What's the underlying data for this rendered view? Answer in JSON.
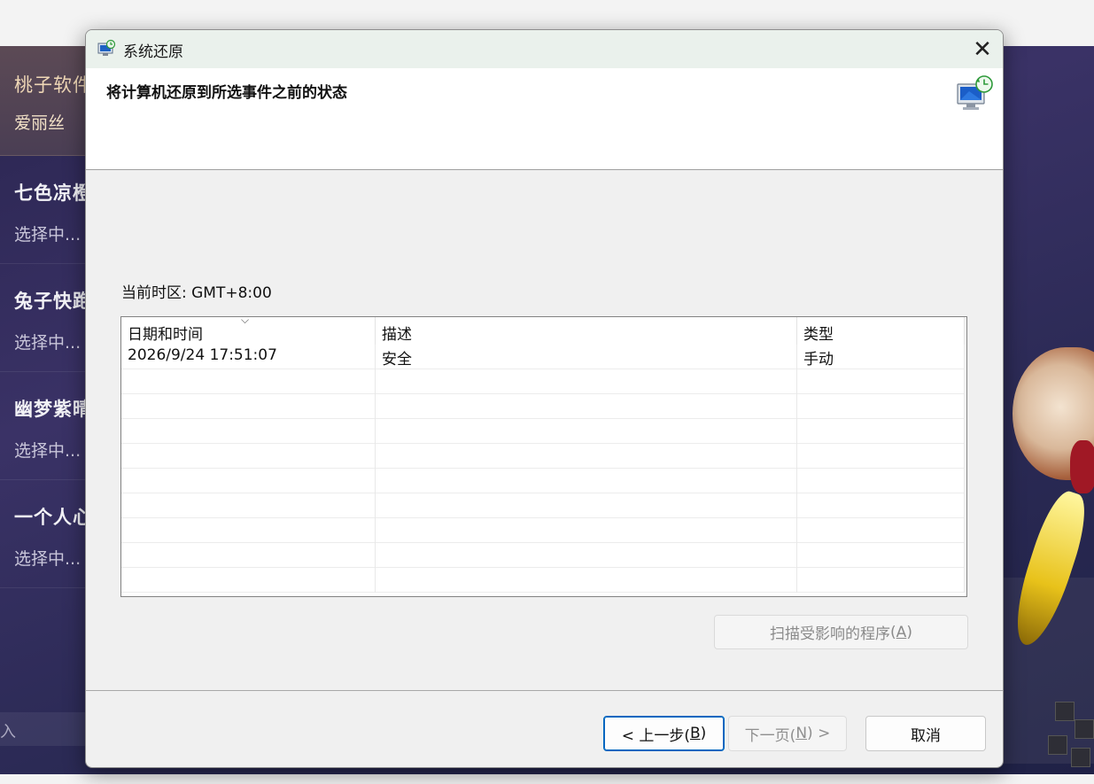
{
  "background_app": {
    "items": [
      {
        "title": "桃子软件",
        "subtitle": "爱丽丝"
      },
      {
        "title": "七色凉橙",
        "subtitle": "选择中..."
      },
      {
        "title": "兔子快跑",
        "subtitle": "选择中..."
      },
      {
        "title": "幽梦紫晴",
        "subtitle": "选择中..."
      },
      {
        "title": "一个人心",
        "subtitle": "选择中..."
      }
    ],
    "input_text": "入"
  },
  "dialog": {
    "title": "系统还原",
    "close_glyph": "✕",
    "header_title": "将计算机还原到所选事件之前的状态",
    "timezone_label": "当前时区: GMT+8:00",
    "table": {
      "sort_glyph": "⌵",
      "columns": [
        "日期和时间",
        "描述",
        "类型"
      ],
      "rows": [
        [
          "2026/9/24 17:51:07",
          "安全",
          "手动"
        ]
      ],
      "empty_rows": 9
    },
    "scan_button": {
      "label": "扫描受影响的程序",
      "accel": "A"
    },
    "buttons": {
      "back": {
        "prefix": "< 上一步(",
        "accel": "B",
        "suffix": ")"
      },
      "next": {
        "prefix": "下一页(",
        "accel": "N",
        "suffix": ") >"
      },
      "cancel": "取消"
    }
  },
  "icons": {
    "title_icon": "system-restore-icon",
    "header_icon": "system-restore-monitor-icon",
    "close": "close-icon"
  },
  "colors": {
    "accent": "#0067c0",
    "dialog_bg": "#f0f0f0",
    "header_bg": "#ffffff",
    "disabled_text": "#8f8f8f"
  }
}
